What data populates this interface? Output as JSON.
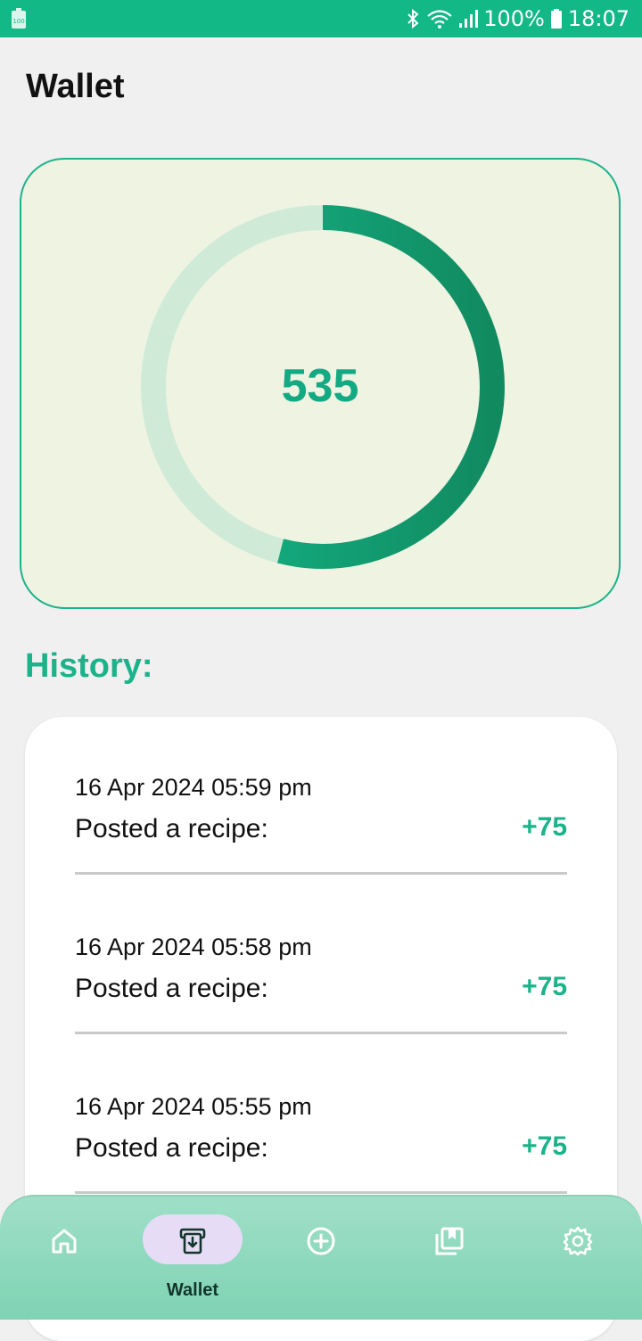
{
  "status_bar": {
    "battery_percent": "100%",
    "time": "18:07",
    "icons": [
      "battery-small-icon",
      "bluetooth-icon",
      "wifi-icon",
      "signal-icon",
      "battery-icon"
    ]
  },
  "page": {
    "title": "Wallet"
  },
  "balance": {
    "value": "535",
    "progress_fraction": 0.54,
    "colors": {
      "progress_start": "#13b98b",
      "progress_end": "#128a60",
      "track": "#d0ead8",
      "card_background": "#eef3e2",
      "card_border": "#1bb38a"
    }
  },
  "history": {
    "heading": "History:",
    "items": [
      {
        "date": "16 Apr 2024 05:59 pm",
        "description": "Posted a recipe:",
        "amount": "+75"
      },
      {
        "date": "16 Apr 2024 05:58 pm",
        "description": "Posted a recipe:",
        "amount": "+75"
      },
      {
        "date": "16 Apr 2024 05:55 pm",
        "description": "Posted a recipe:",
        "amount": "+75"
      }
    ]
  },
  "nav": {
    "items": [
      {
        "icon": "home-icon",
        "label": "",
        "active": false
      },
      {
        "icon": "wallet-icon",
        "label": "Wallet",
        "active": true
      },
      {
        "icon": "add-circle-icon",
        "label": "",
        "active": false
      },
      {
        "icon": "bookmark-collection-icon",
        "label": "",
        "active": false
      },
      {
        "icon": "settings-gear-icon",
        "label": "",
        "active": false
      }
    ]
  }
}
